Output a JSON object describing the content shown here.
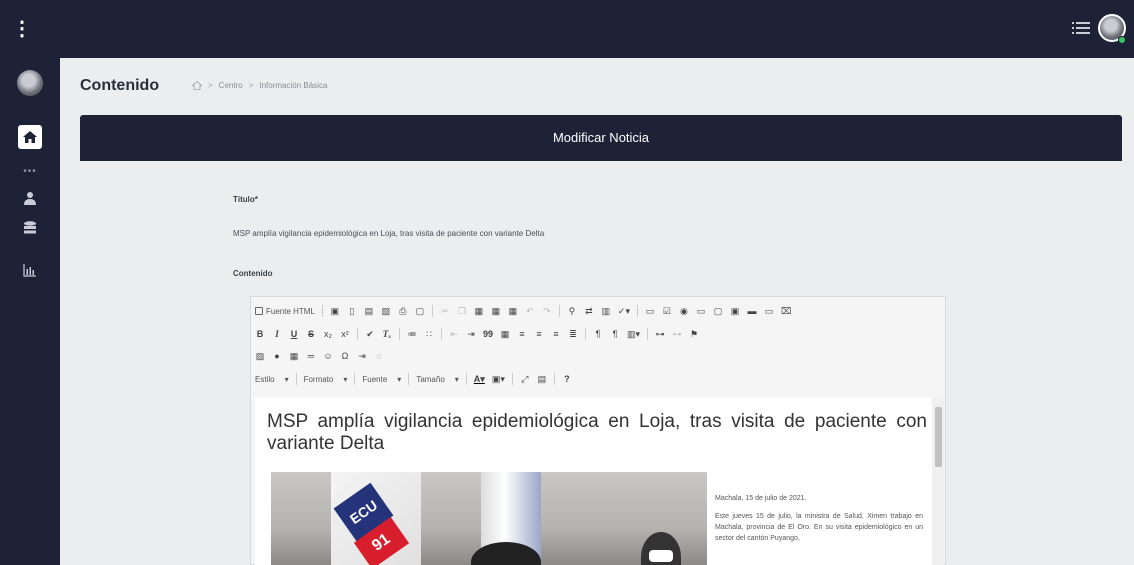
{
  "main": {
    "title": "Contenido",
    "breadcrumb": [
      "Centro",
      "Información Básica"
    ],
    "banner_title": "Modificar Noticia"
  },
  "form": {
    "titulo_label": "Título*",
    "titulo_value": "MSP amplía vigilancia epidemiológica en Loja, tras visita de paciente con variante Delta",
    "contenido_label": "Contenido"
  },
  "editor": {
    "toolbar": {
      "source_label": "Fuente HTML",
      "style_combo": "Estilo",
      "format_combo": "Formato",
      "font_combo": "Fuente",
      "size_combo": "Tamaño",
      "help": "?"
    },
    "article": {
      "heading": "MSP amplía vigilancia epidemiológica en Loja, tras visita de paciente con variante Delta",
      "image_text_1": "ECU",
      "image_text_2": "91",
      "dateline": "Machala, 15 de julio de 2021.",
      "paragraph": "Este jueves 15 de julio, la ministra de Salud, Ximen trabajo en Machala, provincia de El Oro. En su visita epidemiológico en un sector del cantón Puyango,"
    }
  }
}
